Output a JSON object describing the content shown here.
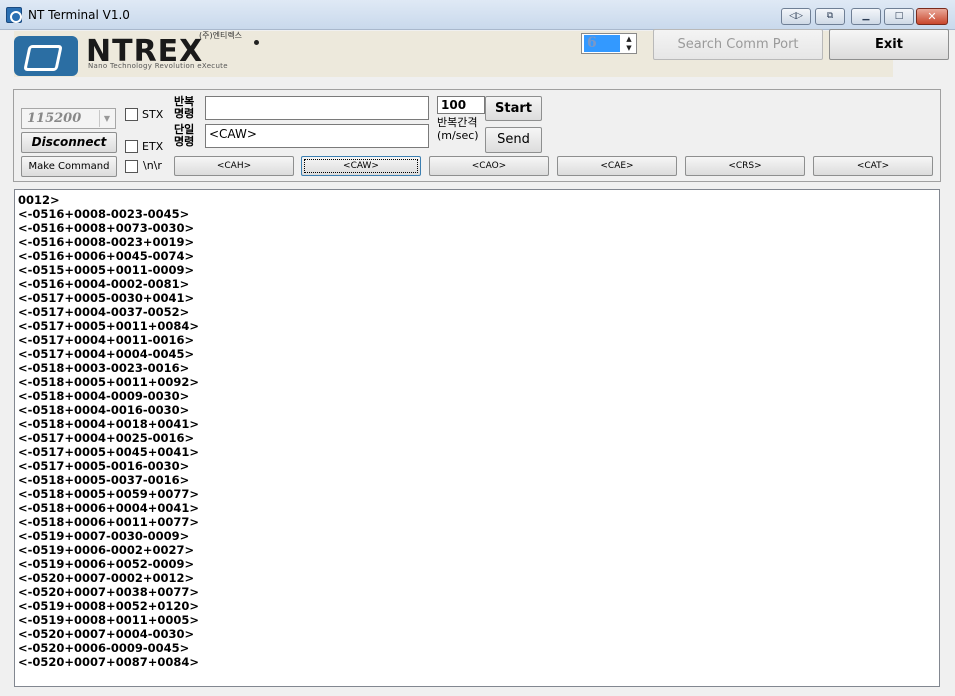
{
  "window": {
    "title": "NT Terminal V1.0"
  },
  "title_buttons": [
    {
      "name": "extra-icon-1",
      "glyph": "◁▷"
    },
    {
      "name": "extra-icon-2",
      "glyph": "⧉"
    },
    {
      "name": "minimize-icon",
      "glyph": "▁"
    },
    {
      "name": "maximize-icon",
      "glyph": "□"
    },
    {
      "name": "close-icon",
      "glyph": "✕"
    }
  ],
  "logo": {
    "brand": "NTREX",
    "korean": "(주)엔티렉스",
    "tagline": "Nano Technology Revolution eXecute"
  },
  "port": {
    "value": "6"
  },
  "header_buttons": {
    "search": "Search Comm Port",
    "exit": "Exit"
  },
  "controls": {
    "baud": "115200",
    "disconnect": "Disconnect",
    "make_command": "Make Command",
    "stx": "STX",
    "etx": "ETX",
    "newline": "\\n\\r",
    "repeat_label": "반복\n명령",
    "single_label": "단일\n명령",
    "repeat_command": "",
    "single_command": "<CAW>",
    "interval": "100",
    "interval_label": "반복간격\n(m/sec)",
    "start": "Start",
    "send": "Send"
  },
  "command_buttons": [
    "<CAH>",
    "<CAW>",
    "<CAO>",
    "<CAE>",
    "<CRS>",
    "<CAT>"
  ],
  "output": {
    "lines": [
      "0012>",
      "<-0516+0008-0023-0045>",
      "<-0516+0008+0073-0030>",
      "<-0516+0008-0023+0019>",
      "<-0516+0006+0045-0074>",
      "<-0515+0005+0011-0009>",
      "<-0516+0004-0002-0081>",
      "<-0517+0005-0030+0041>",
      "<-0517+0004-0037-0052>",
      "<-0517+0005+0011+0084>",
      "<-0517+0004+0011-0016>",
      "<-0517+0004+0004-0045>",
      "<-0518+0003-0023-0016>",
      "<-0518+0005+0011+0092>",
      "<-0518+0004-0009-0030>",
      "<-0518+0004-0016-0030>",
      "<-0518+0004+0018+0041>",
      "<-0517+0004+0025-0016>",
      "<-0517+0005+0045+0041>",
      "<-0517+0005-0016-0030>",
      "<-0518+0005-0037-0016>",
      "<-0518+0005+0059+0077>",
      "<-0518+0006+0004+0041>",
      "<-0518+0006+0011+0077>",
      "<-0519+0007-0030-0009>",
      "<-0519+0006-0002+0027>",
      "<-0519+0006+0052-0009>",
      "<-0520+0007-0002+0012>",
      "<-0520+0007+0038+0077>",
      "<-0519+0008+0052+0120>",
      "<-0519+0008+0011+0005>",
      "<-0520+0007+0004-0030>",
      "<-0520+0006-0009-0045>",
      "<-0520+0007+0087+0084>"
    ]
  }
}
